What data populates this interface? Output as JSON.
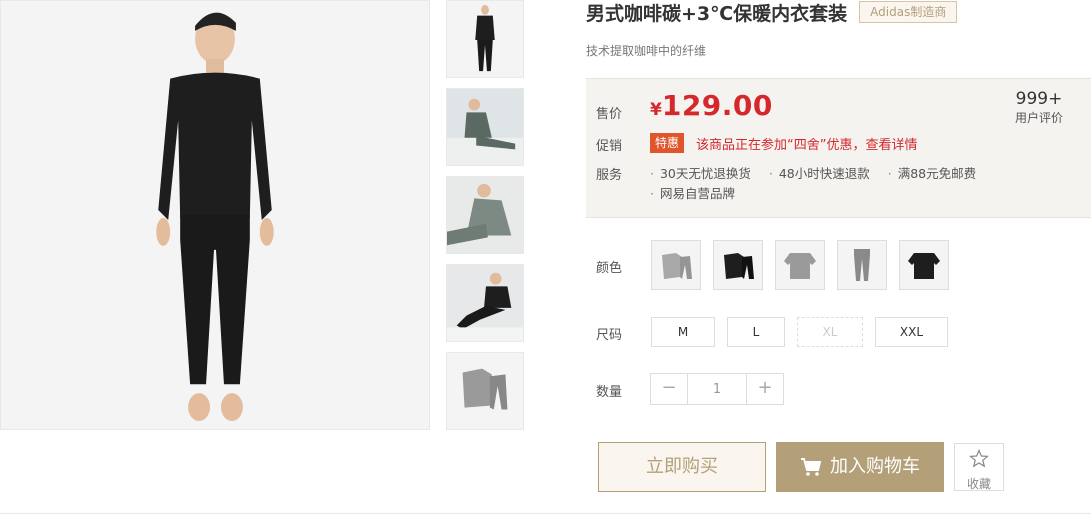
{
  "product": {
    "title": "男式咖啡碳+3℃保暖内衣套装",
    "maker_badge": "Adidas制造商",
    "subtitle": "技术提取咖啡中的纤维"
  },
  "price_box": {
    "price_label": "售价",
    "currency": "¥",
    "price": "129.00",
    "promo_label": "促销",
    "promo_tag": "特惠",
    "promo_text": "该商品正在参加“四舍”优惠，查看详情",
    "service_label": "服务",
    "services": [
      "30天无忧退换货",
      "48小时快速退款",
      "满88元免邮费",
      "网易自营品牌"
    ],
    "review_count": "999+",
    "review_label": "用户评价"
  },
  "options": {
    "color_label": "颜色",
    "size_label": "尺码",
    "sizes": [
      "M",
      "L",
      "XL",
      "XXL"
    ],
    "quantity_label": "数量",
    "quantity_value": "1",
    "minus": "−",
    "plus": "+"
  },
  "actions": {
    "buy_now": "立即购买",
    "add_to_cart": "加入购物车",
    "favorite": "收藏"
  },
  "colors": {
    "accent": "#b4a078",
    "price_red": "#d4282d",
    "promo_orange": "#e0552c"
  }
}
